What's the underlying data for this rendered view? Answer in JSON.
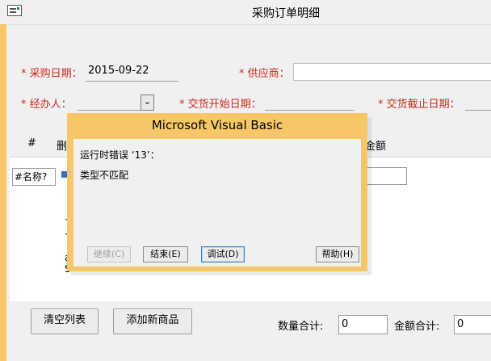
{
  "window": {
    "title": "采购订单明细"
  },
  "header": {
    "purchase_date_label": "* 采购日期：",
    "purchase_date_value": "2015-09-22",
    "supplier_label": "* 供应商：",
    "handler_label": "* 经办人：",
    "delivery_start_label": "* 交货开始日期：",
    "delivery_end_label": "* 交货截止日期："
  },
  "subform": {
    "columns": [
      "#",
      "删",
      "金额"
    ],
    "name_cell": "#名称?",
    "fragments": [
      "·",
      "·",
      "a",
      "S"
    ]
  },
  "footer": {
    "clear_label": "清空列表",
    "add_label": "添加新商品",
    "total_qty_label": "数量合计:",
    "total_qty_value": "0",
    "total_amount_label": "金额合计:",
    "total_amount_value": "0"
  },
  "dialog": {
    "title": "Microsoft Visual Basic",
    "error_line": "运行时错误 ‘13’：",
    "error_desc": "类型不匹配",
    "btn_continue": "继续(C)",
    "btn_end": "结束(E)",
    "btn_debug": "调试(D)",
    "btn_help": "帮助(H)"
  },
  "colors": {
    "accent": "#f6c766",
    "required": "#cc2a1f"
  }
}
